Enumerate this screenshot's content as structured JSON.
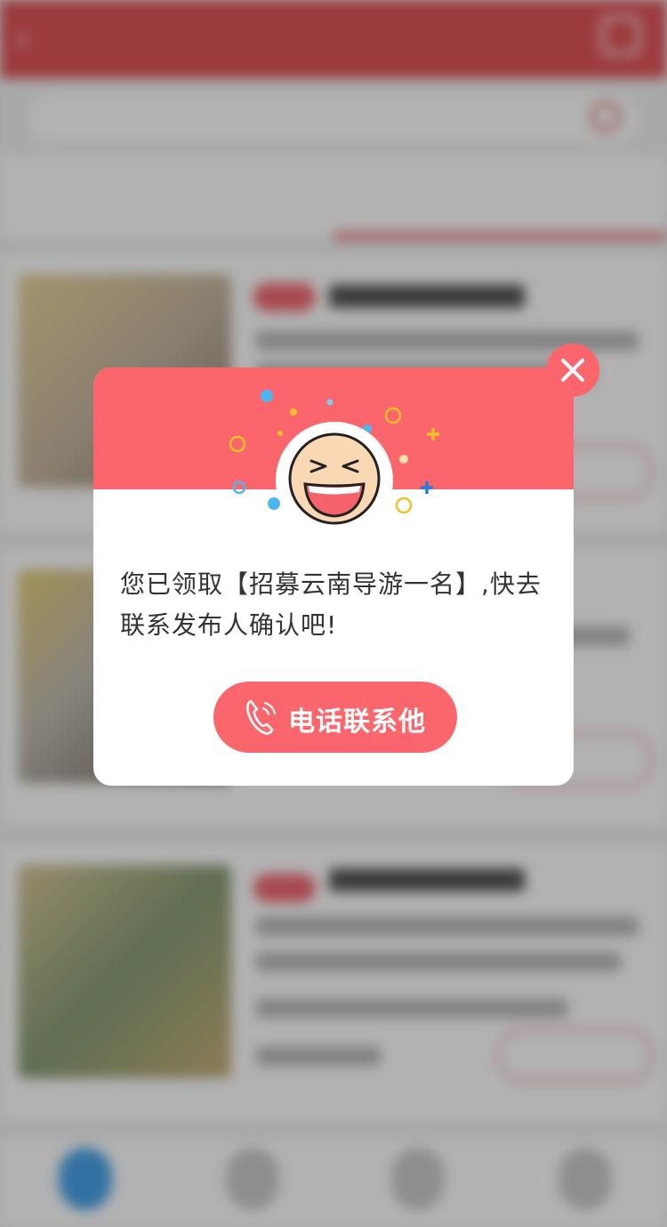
{
  "modal": {
    "message": "您已领取【招募云南导游一名】,快去联系发布人确认吧!",
    "call_label": "电话联系他",
    "close_icon": "close-icon",
    "phone_icon": "phone-icon"
  },
  "colors": {
    "accent": "#fa666c",
    "overlay": "rgba(0,0,0,0.30)"
  }
}
